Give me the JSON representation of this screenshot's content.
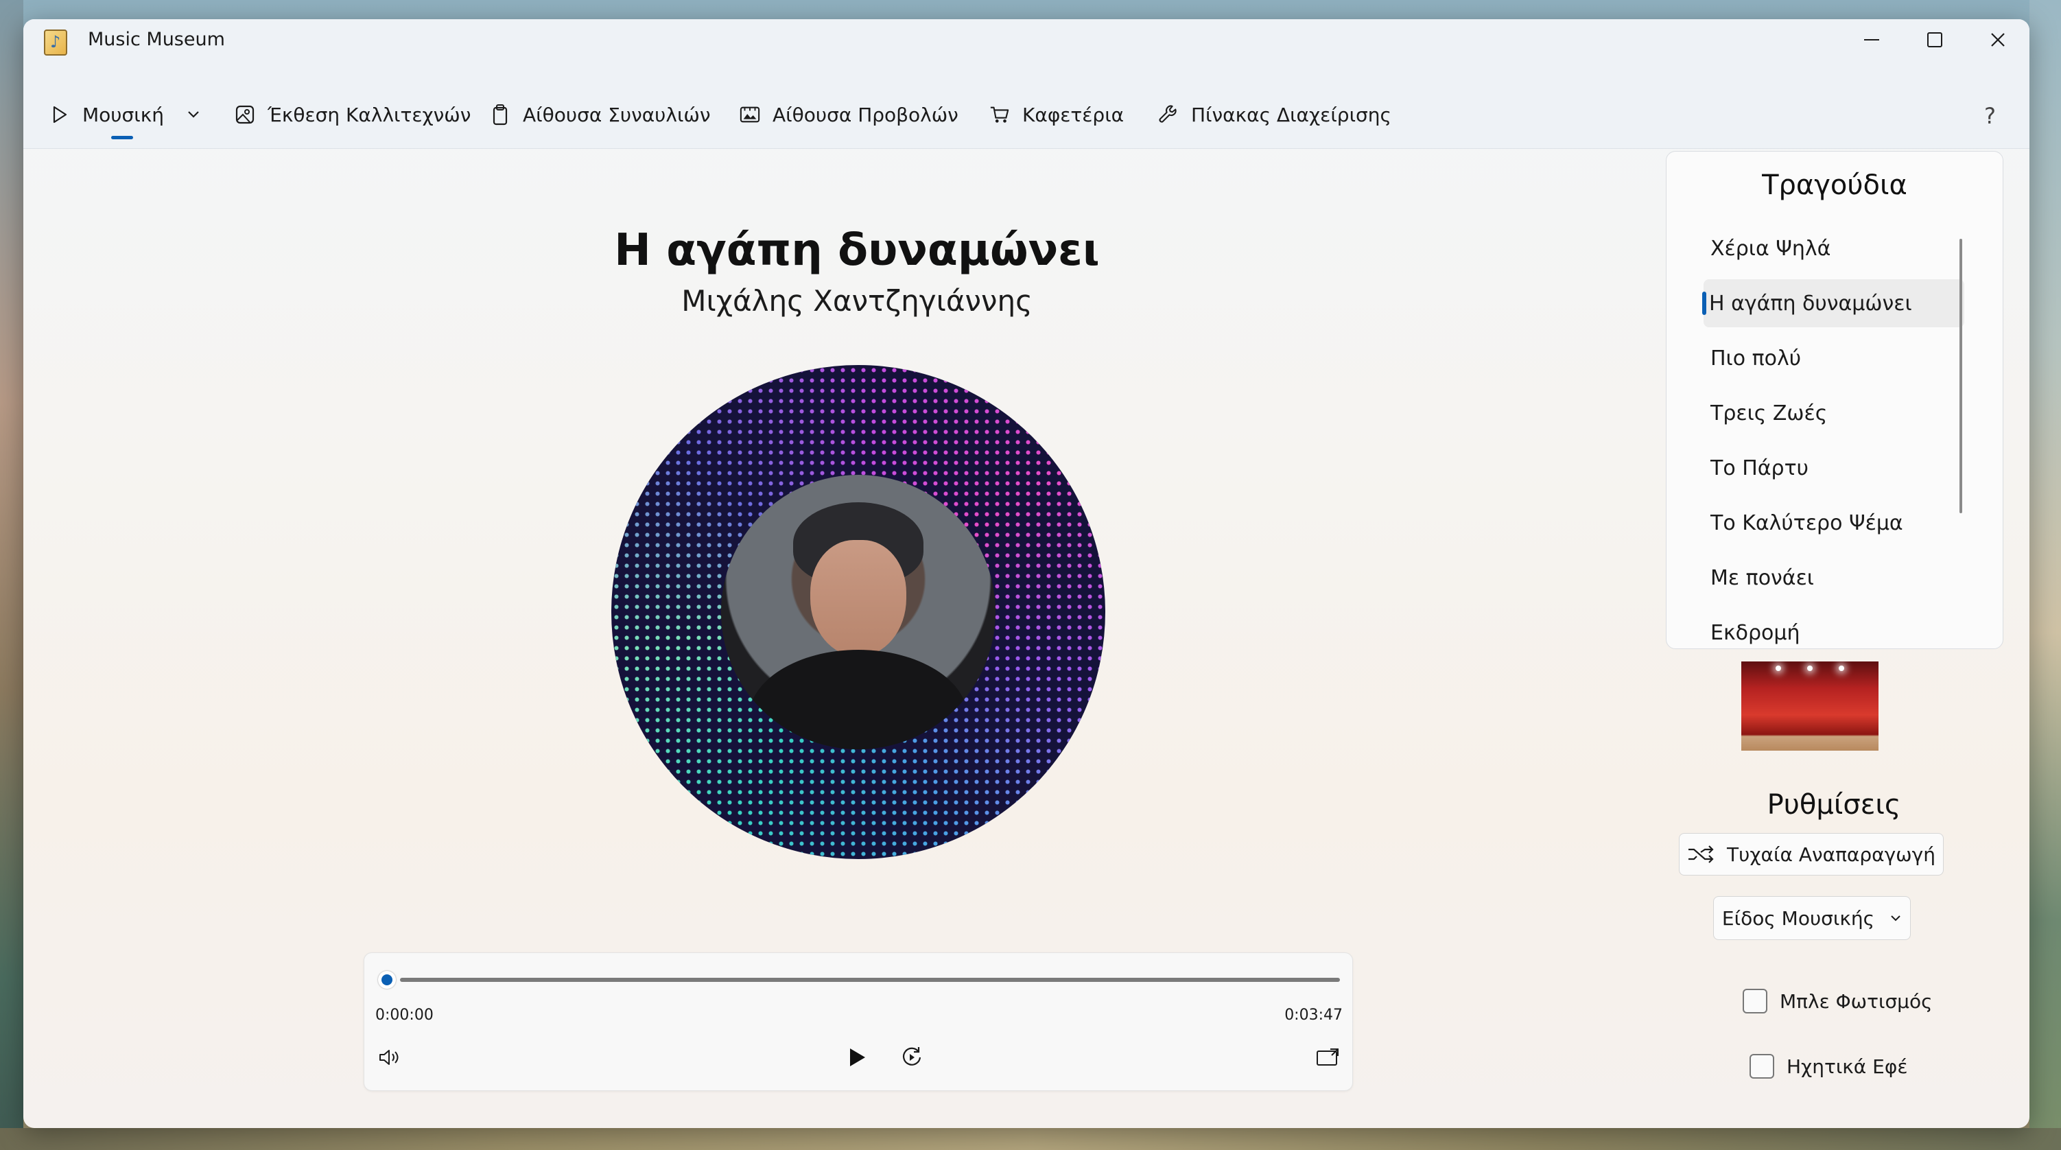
{
  "window": {
    "title": "Music Museum"
  },
  "nav": {
    "items": [
      {
        "label": "Μουσική",
        "icon": "play-icon",
        "has_dropdown": true,
        "selected": true
      },
      {
        "label": "Έκθεση Καλλιτεχνών",
        "icon": "image-icon"
      },
      {
        "label": "Αίθουσα Συναυλιών",
        "icon": "clipboard-icon"
      },
      {
        "label": "Αίθουσα Προβολών",
        "icon": "gallery-icon"
      },
      {
        "label": "Καφετέρια",
        "icon": "cart-icon"
      },
      {
        "label": "Πίνακας Διαχείρισης",
        "icon": "wrench-icon"
      }
    ],
    "help": "?"
  },
  "now_playing": {
    "title": "Η αγάπη δυναμώνει",
    "artist": "Μιχάλης Χαντζηγιάννης"
  },
  "player": {
    "current_time": "0:00:00",
    "total_time": "0:03:47",
    "progress": 0
  },
  "songs": {
    "title": "Τραγούδια",
    "items": [
      {
        "label": "Χέρια Ψηλά"
      },
      {
        "label": "Η αγάπη δυναμώνει",
        "selected": true
      },
      {
        "label": "Πιο πολύ"
      },
      {
        "label": "Τρεις Ζωές"
      },
      {
        "label": "Το Πάρτυ"
      },
      {
        "label": "Το Καλύτερο Ψέμα"
      },
      {
        "label": "Με πονάει"
      },
      {
        "label": "Εκδρομή"
      }
    ]
  },
  "settings": {
    "title": "Ρυθμίσεις",
    "shuffle_label": "Τυχαία Αναπαραγωγή",
    "genre_label": "Είδος Μουσικής",
    "blue_light_label": "Μπλε Φωτισμός",
    "blue_light_checked": false,
    "sound_fx_label": "Ηχητικά Εφέ",
    "sound_fx_checked": false
  },
  "colors": {
    "accent": "#0a5fb4"
  }
}
